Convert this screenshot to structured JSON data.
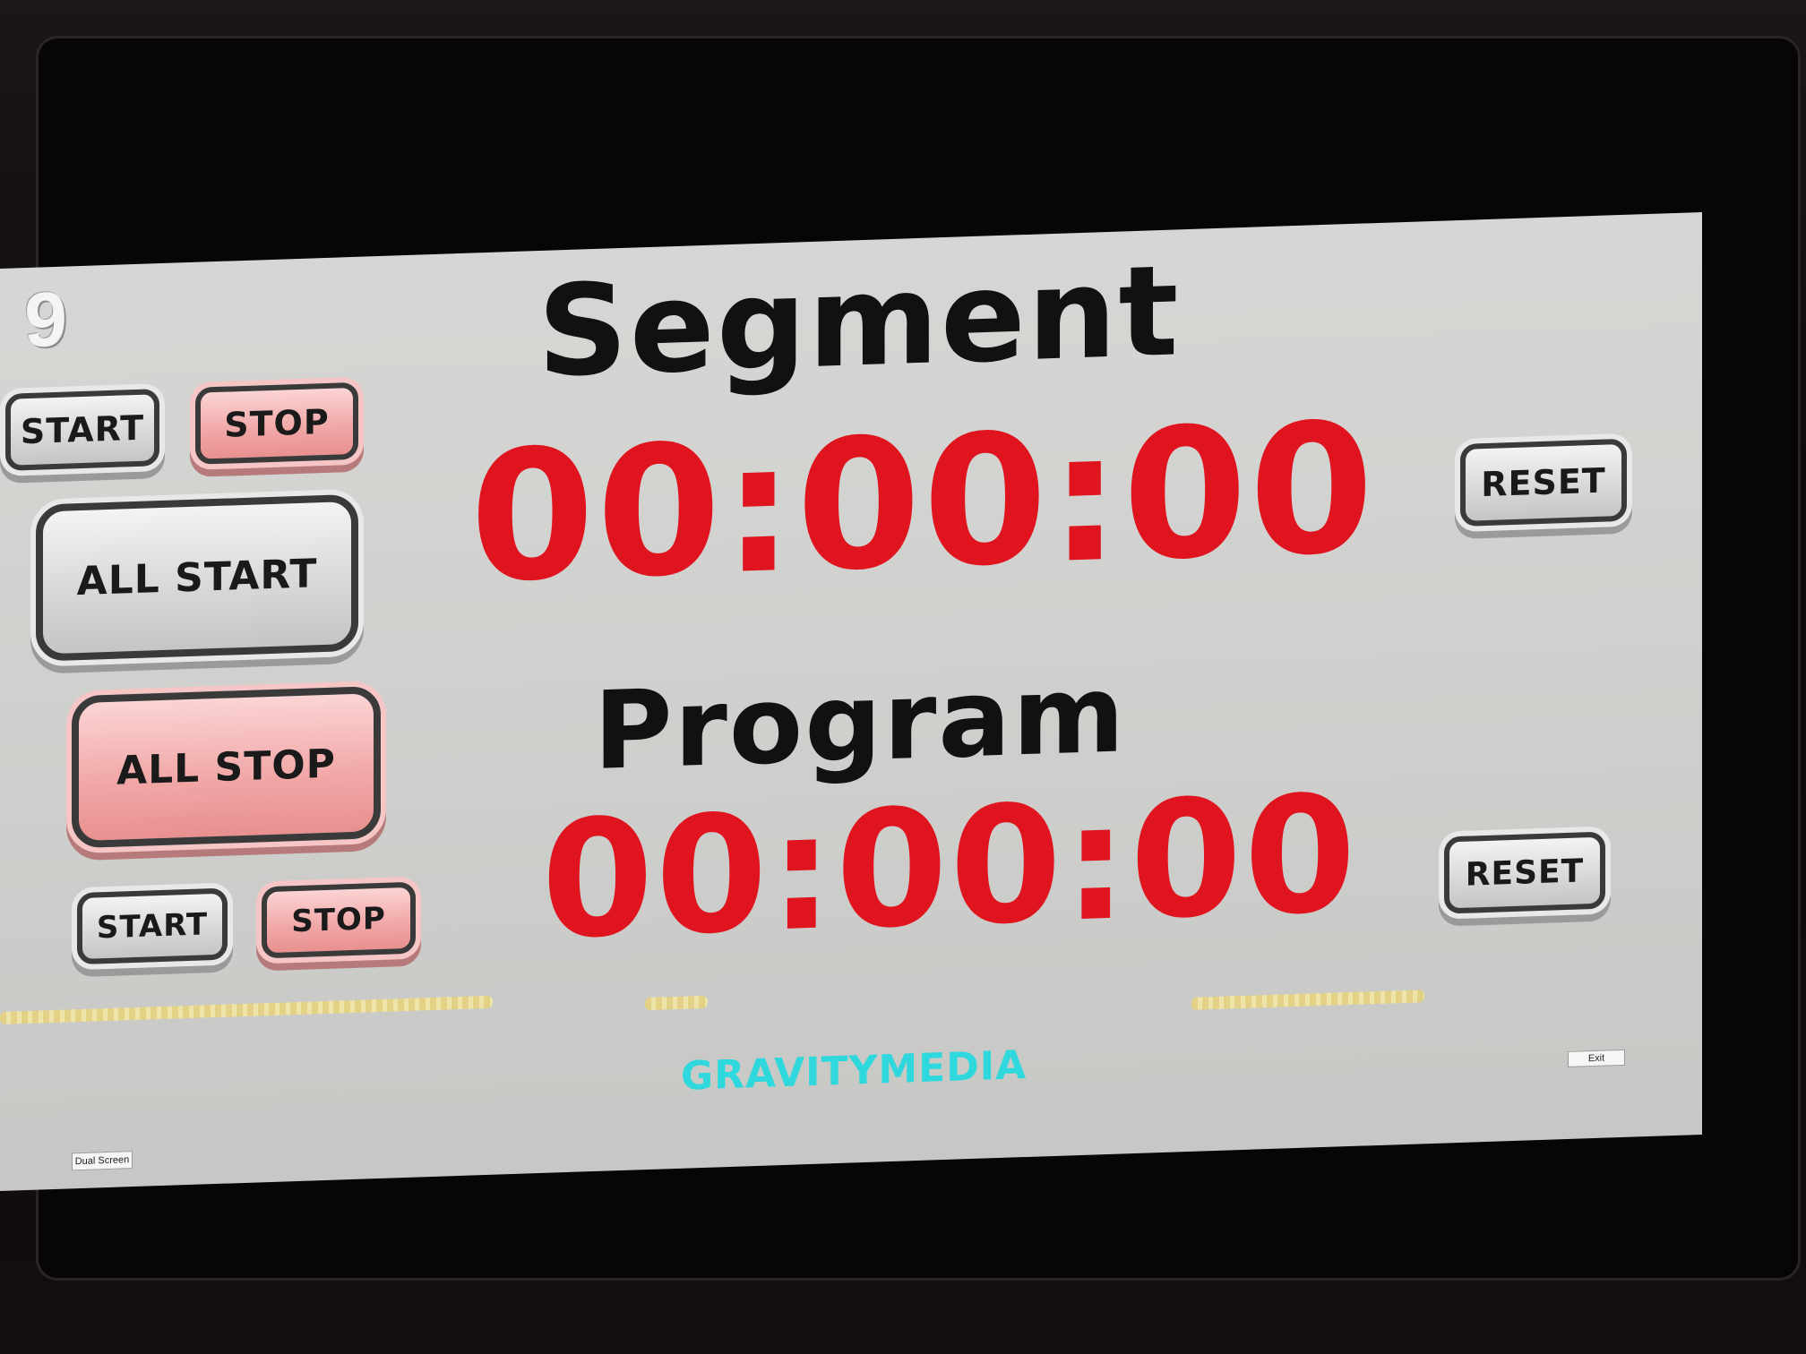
{
  "app": {
    "logo_glyph": "9"
  },
  "segment": {
    "title": "Segment",
    "time": "00:00:00",
    "start_label": "START",
    "stop_label": "STOP",
    "reset_label": "RESET"
  },
  "program": {
    "title": "Program",
    "time": "00:00:00",
    "start_label": "START",
    "stop_label": "STOP",
    "reset_label": "RESET"
  },
  "global": {
    "all_start_label": "ALL START",
    "all_stop_label": "ALL STOP"
  },
  "footer": {
    "brand": "GRAVITYMEDIA",
    "dual_screen_label": "Dual Screen",
    "exit_label": "Exit"
  },
  "colors": {
    "timer": "#e0141e",
    "stop_button": "#f1a6a6",
    "start_button": "#d9d9d9",
    "brand": "#2fd8dc",
    "background": "#d1d2cf"
  }
}
